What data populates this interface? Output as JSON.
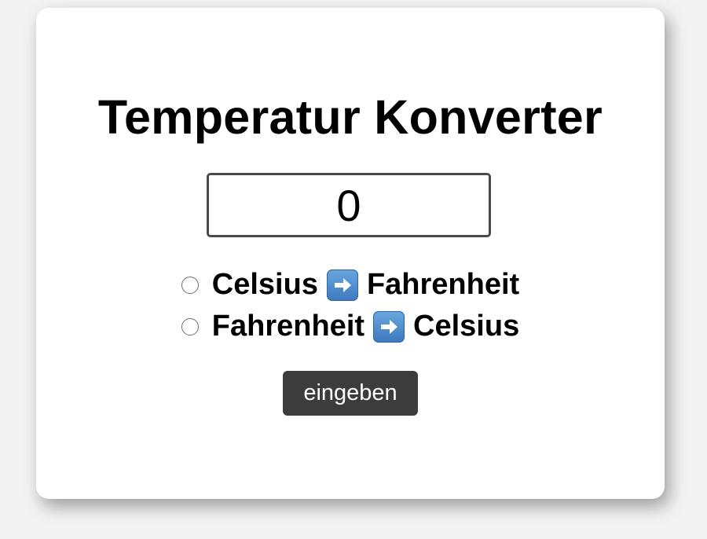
{
  "app": {
    "title": "Temperatur Konverter"
  },
  "input": {
    "value": "0"
  },
  "options": [
    {
      "from": "Celsius",
      "to": "Fahrenheit",
      "selected": false
    },
    {
      "from": "Fahrenheit",
      "to": "Celsius",
      "selected": false
    }
  ],
  "icons": {
    "arrow": "right-arrow-icon"
  },
  "button": {
    "label": "eingeben"
  },
  "colors": {
    "background": "#f3f3f3",
    "card": "#ffffff",
    "button": "#3c3c3c",
    "arrow_icon": "#4a8bd0"
  }
}
